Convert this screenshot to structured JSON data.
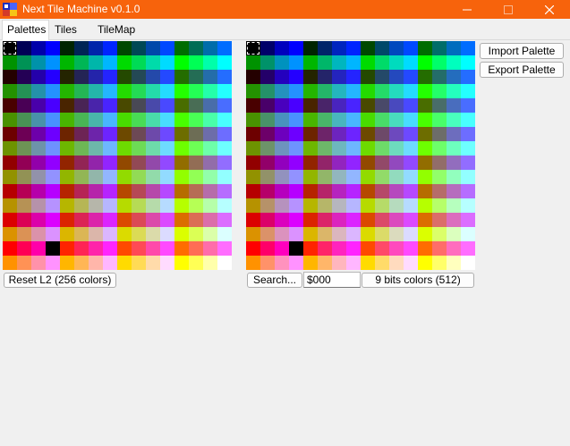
{
  "window": {
    "title": "Next Tile Machine v0.1.0",
    "accent_color": "#f7630c",
    "icons": {
      "app": "app-icon",
      "minimize": "minimize-icon",
      "maximize": "maximize-icon",
      "close": "close-icon"
    }
  },
  "tabs": [
    {
      "label": "Palettes",
      "active": true
    },
    {
      "label": "Tiles",
      "active": false
    },
    {
      "label": "TileMap",
      "active": false
    }
  ],
  "left_palette": {
    "columns": 16,
    "rows": 16,
    "selected_index": 0,
    "black_cell_index": 227,
    "reset_button_label": "Reset L2 (256 colors)"
  },
  "right_palette": {
    "columns": 16,
    "rows": 16,
    "selected_index": 0,
    "black_cell_index": 227,
    "search_button_label": "Search...",
    "search_value": "$000",
    "mode_button_label": "9 bits colors (512)"
  },
  "side_buttons": {
    "import_label": "Import Palette",
    "export_label": "Export Palette"
  }
}
